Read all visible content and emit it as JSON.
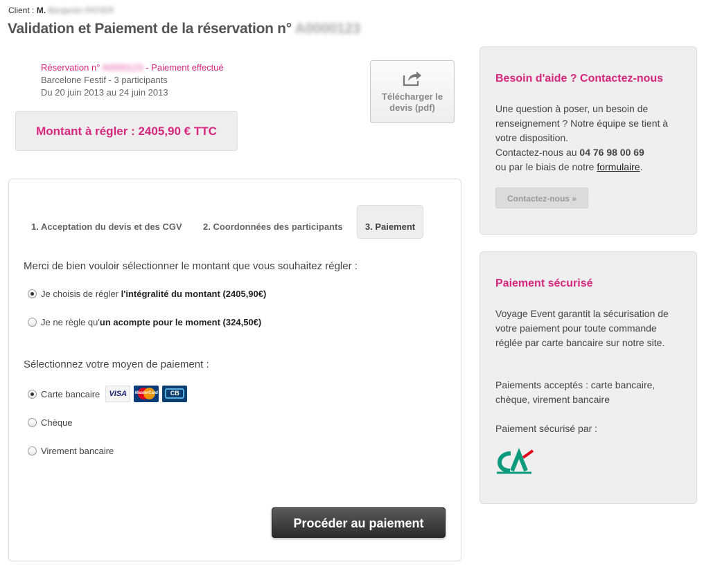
{
  "header": {
    "client_prefix": "Client :",
    "client_title": "M.",
    "client_name": "Benjamin PATIER",
    "title_prefix": "Validation et Paiement de la réservation n°",
    "reservation_number": "A0000123"
  },
  "reservation": {
    "label_prefix": "Réservation n°",
    "number": "A0000123",
    "status": "- Paiement effectué",
    "event": "Barcelone Festif - 3 participants",
    "dates": "Du 20 juin 2013 au 24 juin 2013"
  },
  "download": {
    "line1": "Télécharger le",
    "line2": "devis (pdf)"
  },
  "amount": {
    "label": "Montant à régler : 2405,90 € TTC"
  },
  "tabs": [
    {
      "label": "1. Acceptation du devis et des CGV"
    },
    {
      "label": "2. Coordonnées des participants"
    },
    {
      "label": "3. Paiement"
    }
  ],
  "amount_choice": {
    "question": "Merci de bien vouloir sélectionner le montant que vous souhaitez régler :",
    "options": [
      {
        "prefix": "Je choisis de régler ",
        "bold": "l'intégralité du montant (2405,90€)",
        "checked": true
      },
      {
        "prefix": "Je ne règle qu'",
        "bold": "un acompte pour le moment (324,50€)",
        "checked": false
      }
    ]
  },
  "payment_method": {
    "question": "Sélectionnez votre moyen de paiement :",
    "options": [
      {
        "label": "Carte bancaire",
        "checked": true
      },
      {
        "label": "Chèque",
        "checked": false
      },
      {
        "label": "Virement bancaire",
        "checked": false
      }
    ],
    "cards": [
      "VISA",
      "MasterCard",
      "CB"
    ]
  },
  "pay_button": {
    "label": "Procéder au paiement"
  },
  "help": {
    "title": "Besoin d'aide ? Contactez-nous",
    "text1": "Une question à poser, un besoin de renseignement ? Notre équipe se tient à votre disposition.",
    "text2_prefix": "Contactez-nous au ",
    "phone": "04 76 98 00 69",
    "text3_prefix": "ou par le biais de notre ",
    "form_link": "formulaire",
    "text3_suffix": ".",
    "button": "Contactez-nous »"
  },
  "secure": {
    "title": "Paiement sécurisé",
    "text1": "Voyage Event garantit la sécurisation de votre paiement pour toute commande réglée par carte bancaire sur notre site.",
    "text2": "Paiements acceptés : carte bancaire, chèque, virement bancaire",
    "text3": "Paiement sécurisé par :"
  },
  "colors": {
    "accent": "#d6267d",
    "ca_green": "#0b9a7c",
    "ca_red": "#e2001a"
  }
}
